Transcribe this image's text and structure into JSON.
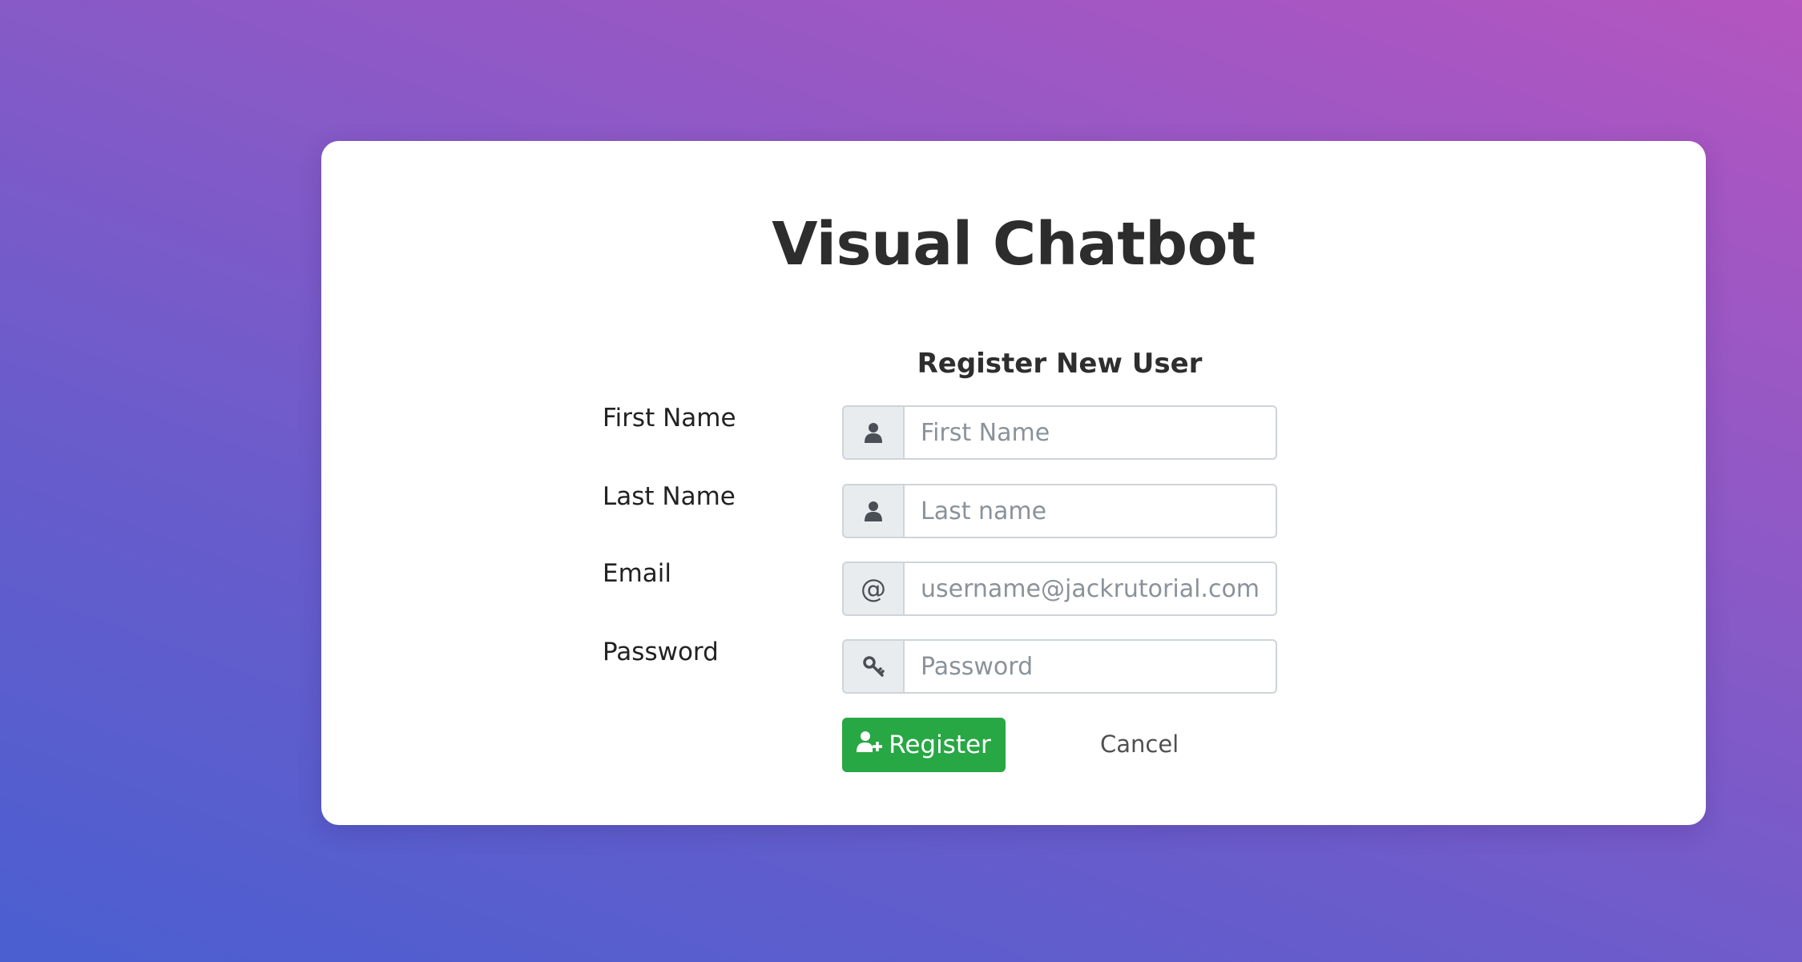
{
  "app": {
    "title": "Visual Chatbot"
  },
  "form": {
    "heading": "Register New User",
    "fields": [
      {
        "label": "First Name",
        "placeholder": "First Name",
        "value": "",
        "icon": "user-icon"
      },
      {
        "label": "Last Name",
        "placeholder": "Last name",
        "value": "",
        "icon": "user-icon"
      },
      {
        "label": "Email",
        "placeholder": "username@jackrutorial.com",
        "value": "",
        "icon": "at-sign-icon",
        "icon_text": "@"
      },
      {
        "label": "Password",
        "placeholder": "Password",
        "value": "",
        "icon": "key-icon"
      }
    ],
    "register_label": "Register",
    "register_icon": "user-plus-icon",
    "cancel_label": "Cancel"
  },
  "colors": {
    "accent_green": "#28a745",
    "title_text": "#2d2d2d",
    "addon_bg": "#e9ecef",
    "background_gradient": [
      "#4a5fd0",
      "#8d59c6",
      "#b455c0"
    ]
  }
}
